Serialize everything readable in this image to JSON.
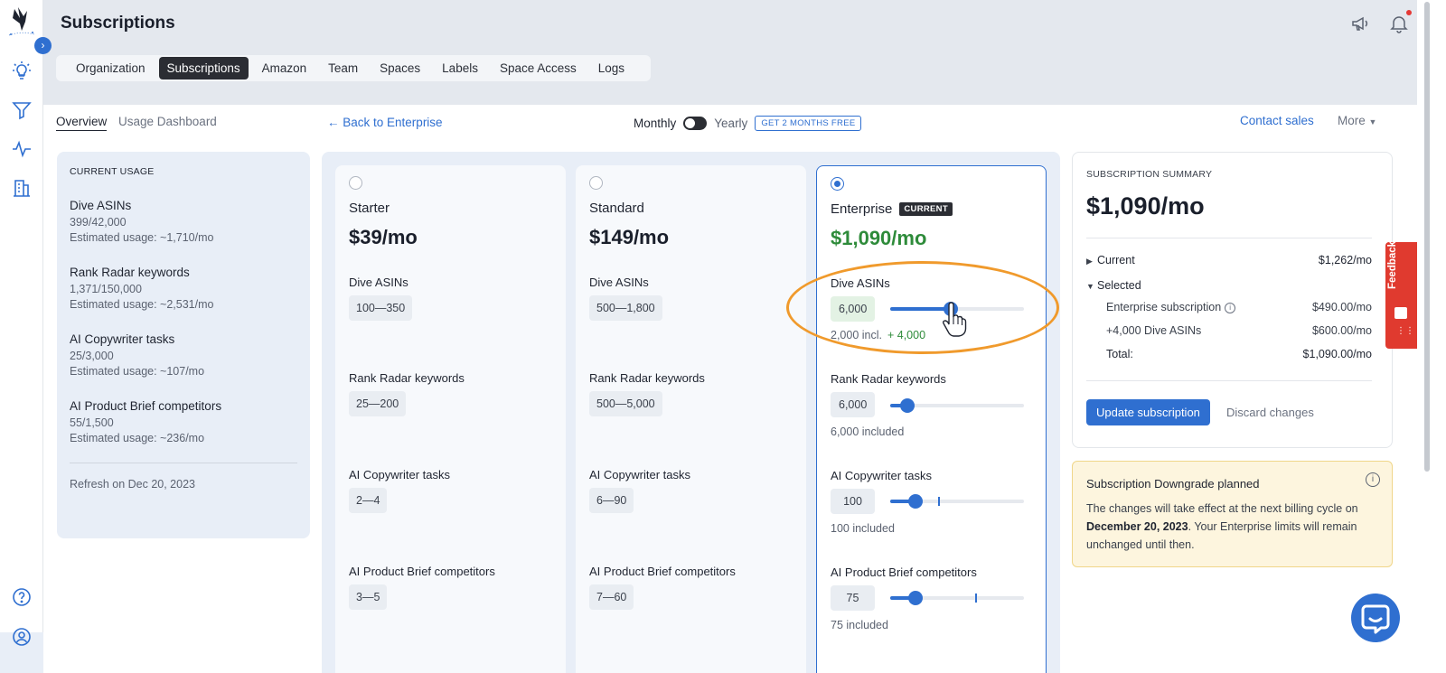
{
  "header": {
    "title": "Subscriptions",
    "tabs": [
      "Organization",
      "Subscriptions",
      "Amazon",
      "Team",
      "Spaces",
      "Labels",
      "Space Access",
      "Logs"
    ]
  },
  "subnav": {
    "overview": "Overview",
    "usage_dashboard": "Usage Dashboard",
    "back": "Back to Enterprise",
    "monthly": "Monthly",
    "yearly": "Yearly",
    "promo": "GET 2 MONTHS FREE",
    "contact": "Contact sales",
    "more": "More"
  },
  "usage": {
    "heading": "CURRENT USAGE",
    "items": [
      {
        "name": "Dive ASINs",
        "value": "399/42,000",
        "estimate": "Estimated usage: ~1,710/mo"
      },
      {
        "name": "Rank Radar keywords",
        "value": "1,371/150,000",
        "estimate": "Estimated usage: ~2,531/mo"
      },
      {
        "name": "AI Copywriter tasks",
        "value": "25/3,000",
        "estimate": "Estimated usage: ~107/mo"
      },
      {
        "name": "AI Product Brief competitors",
        "value": "55/1,500",
        "estimate": "Estimated usage: ~236/mo"
      }
    ],
    "refresh": "Refresh on Dec 20, 2023"
  },
  "plans": {
    "feature_labels": [
      "Dive ASINs",
      "Rank Radar keywords",
      "AI Copywriter tasks",
      "AI Product Brief competitors"
    ],
    "starter": {
      "name": "Starter",
      "price": "$39/mo",
      "ranges": [
        "100—350",
        "25—200",
        "2—4",
        "3—5"
      ]
    },
    "standard": {
      "name": "Standard",
      "price": "$149/mo",
      "ranges": [
        "500—1,800",
        "500—5,000",
        "6—90",
        "7—60"
      ]
    },
    "enterprise": {
      "name": "Enterprise",
      "badge": "CURRENT",
      "price": "$1,090/mo",
      "fields": [
        {
          "value": "6,000",
          "included": "2,000 incl.",
          "extra": "+ 4,000",
          "level": 0.45
        },
        {
          "value": "6,000",
          "included": "6,000 included",
          "level": 0.13
        },
        {
          "value": "100",
          "included": "100 included",
          "level": 0.19
        },
        {
          "value": "75",
          "included": "75 included",
          "level": 0.19
        }
      ]
    }
  },
  "summary": {
    "heading": "SUBSCRIPTION SUMMARY",
    "total_big": "$1,090/mo",
    "current_label": "Current",
    "current_value": "$1,262/mo",
    "selected_label": "Selected",
    "lines": [
      {
        "label": "Enterprise subscription",
        "value": "$490.00/mo"
      },
      {
        "label": "+4,000 Dive ASINs",
        "value": "$600.00/mo"
      },
      {
        "label": "Total:",
        "value": "$1,090.00/mo"
      }
    ],
    "update": "Update subscription",
    "discard": "Discard changes"
  },
  "notice": {
    "title": "Subscription Downgrade planned",
    "body_pre": "The changes will take effect at the next billing cycle on ",
    "body_date": "December 20, 2023",
    "body_post": ". Your Enterprise limits will remain unchanged until then."
  },
  "feedback": "Feedback",
  "colors": {
    "accent": "#2f6fd0",
    "green": "#2e8b3a",
    "highlight": "#f09a2c"
  }
}
